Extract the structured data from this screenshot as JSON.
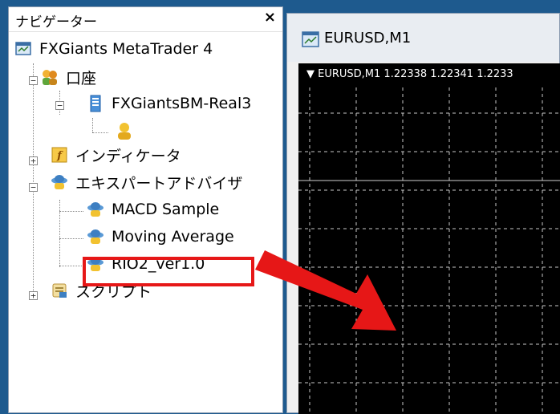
{
  "navigator": {
    "title": "ナビゲーター",
    "close_glyph": "×",
    "items": [
      {
        "label": "FXGiants MetaTrader 4",
        "icon": "platform-icon"
      },
      {
        "label": "口座",
        "icon": "accounts-icon"
      },
      {
        "label": "FXGiantsBM-Real3",
        "icon": "server-icon"
      },
      {
        "label": "",
        "icon": "user-account-icon"
      },
      {
        "label": "インディケータ",
        "icon": "indicators-icon"
      },
      {
        "label": "エキスパートアドバイザ",
        "icon": "expert-advisors-icon"
      },
      {
        "label": "MACD Sample",
        "icon": "expert-icon"
      },
      {
        "label": "Moving Average",
        "icon": "expert-icon"
      },
      {
        "label": "RIO2_ver1.0",
        "icon": "expert-icon"
      },
      {
        "label": "スクリプト",
        "icon": "scripts-icon"
      }
    ]
  },
  "chart": {
    "title": "EURUSD,M1",
    "info": "▼ EURUSD,M1  1.22338 1.22341 1.2233"
  },
  "colors": {
    "background": "#1e5a8e",
    "highlight": "#e61717",
    "arrow": "#e61717",
    "grid": "#c8c8c8"
  }
}
